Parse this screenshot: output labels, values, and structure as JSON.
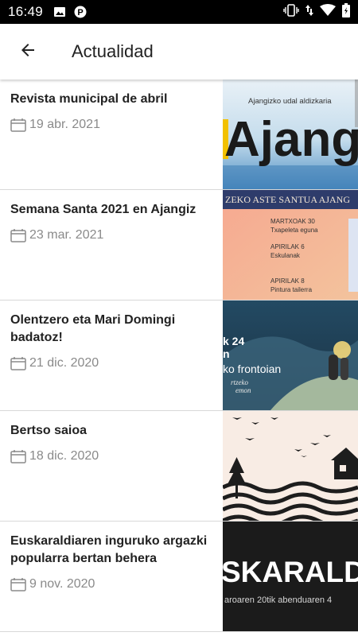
{
  "status_bar": {
    "time": "16:49",
    "icons_left": [
      "image-notification-icon",
      "parking-notification-icon"
    ],
    "icons_right": [
      "vibrate-icon",
      "data-arrows-icon",
      "wifi-icon",
      "battery-icon"
    ]
  },
  "app_bar": {
    "back_icon": "arrow-left-icon",
    "title": "Actualidad"
  },
  "news": [
    {
      "title": "Revista municipal de abril",
      "date": "19 abr. 2021",
      "thumb": {
        "caption": "Ajangizko udal aldizkaria",
        "headline": "Ajangi"
      }
    },
    {
      "title": "Semana Santa 2021 en Ajangiz",
      "date": "23 mar. 2021",
      "thumb": {
        "banner": "ZEKO ASTE   SANTUA  AJANG",
        "lines": [
          "MARTXOAK 30",
          "Txapeleta eguna",
          "APIRILAK 6",
          "Eskulanak",
          "APIRILAK 8",
          "Pintura tailerra"
        ]
      }
    },
    {
      "title": "Olentzero eta Mari Domingi badatoz!",
      "date": "21 dic. 2020",
      "thumb": {
        "lines": [
          "k 24",
          "n",
          "ko frontoian",
          "rtzeko",
          "emon"
        ]
      }
    },
    {
      "title": "Bertso saioa",
      "date": "18 dic. 2020",
      "thumb": {}
    },
    {
      "title": "Euskaraldiaren inguruko argazki popularra bertan behera",
      "date": "9 nov. 2020",
      "thumb": {
        "headline": "SKARALD",
        "sub": "aroaren 20tik abenduaren 4"
      }
    }
  ],
  "colors": {
    "status_bar": "#000000",
    "app_bar": "#ffffff",
    "title_text": "#222222",
    "date_text": "#8a8a8a",
    "divider": "#d8d8d8"
  }
}
